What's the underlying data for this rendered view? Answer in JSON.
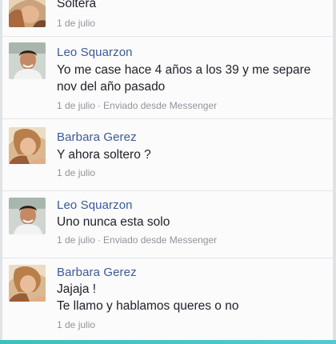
{
  "conversation": {
    "messages": [
      {
        "sender": "",
        "lines": [
          "Soltera"
        ],
        "date": "1 de julio",
        "via": ""
      },
      {
        "sender": "Leo Squarzon",
        "lines": [
          "Yo me case hace 4 años a los 39 y me separe",
          "nov del año pasado"
        ],
        "date": "1 de julio",
        "via": "Enviado desde Messenger"
      },
      {
        "sender": "Barbara Gerez",
        "lines": [
          "Y ahora soltero ?"
        ],
        "date": "1 de julio",
        "via": ""
      },
      {
        "sender": "Leo Squarzon",
        "lines": [
          "Uno nunca esta solo"
        ],
        "date": "1 de julio",
        "via": "Enviado desde Messenger"
      },
      {
        "sender": "Barbara Gerez",
        "lines": [
          "Jajaja !",
          "Te llamo y hablamos queres o no"
        ],
        "date": "1 de julio",
        "via": ""
      }
    ]
  },
  "colors": {
    "sender_name": "#3b5998",
    "message_text": "#1d2129",
    "meta_text": "#90949c",
    "bottom_strip": "#3ac2b8"
  },
  "icons": {
    "male_avatar": "profile-photo-man",
    "female_avatar": "profile-photo-woman"
  }
}
